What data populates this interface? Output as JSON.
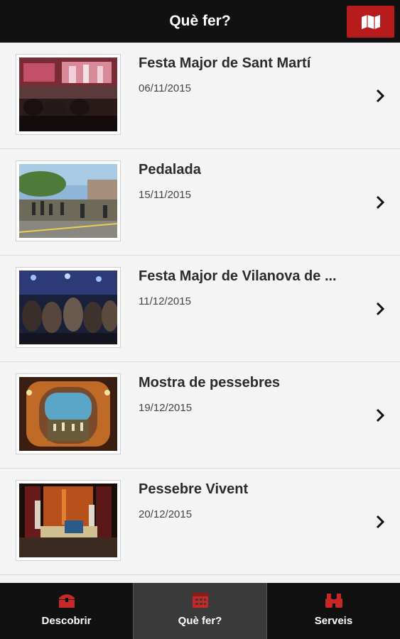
{
  "header": {
    "title": "Què fer?",
    "map_button_icon": "map-icon",
    "accent_color": "#b71c1c"
  },
  "events": [
    {
      "title": "Festa Major de Sant Martí",
      "date": "06/11/2015"
    },
    {
      "title": "Pedalada",
      "date": "15/11/2015"
    },
    {
      "title": "Festa Major de Vilanova de ...",
      "date": "11/12/2015"
    },
    {
      "title": "Mostra de pessebres",
      "date": "19/12/2015"
    },
    {
      "title": "Pessebre Vivent",
      "date": "20/12/2015"
    }
  ],
  "bottom_nav": {
    "tabs": [
      {
        "label": "Descobrir",
        "icon": "treasure-chest-icon",
        "active": false
      },
      {
        "label": "Què fer?",
        "icon": "calendar-icon",
        "active": true
      },
      {
        "label": "Serveis",
        "icon": "binoculars-icon",
        "active": false
      }
    ]
  }
}
